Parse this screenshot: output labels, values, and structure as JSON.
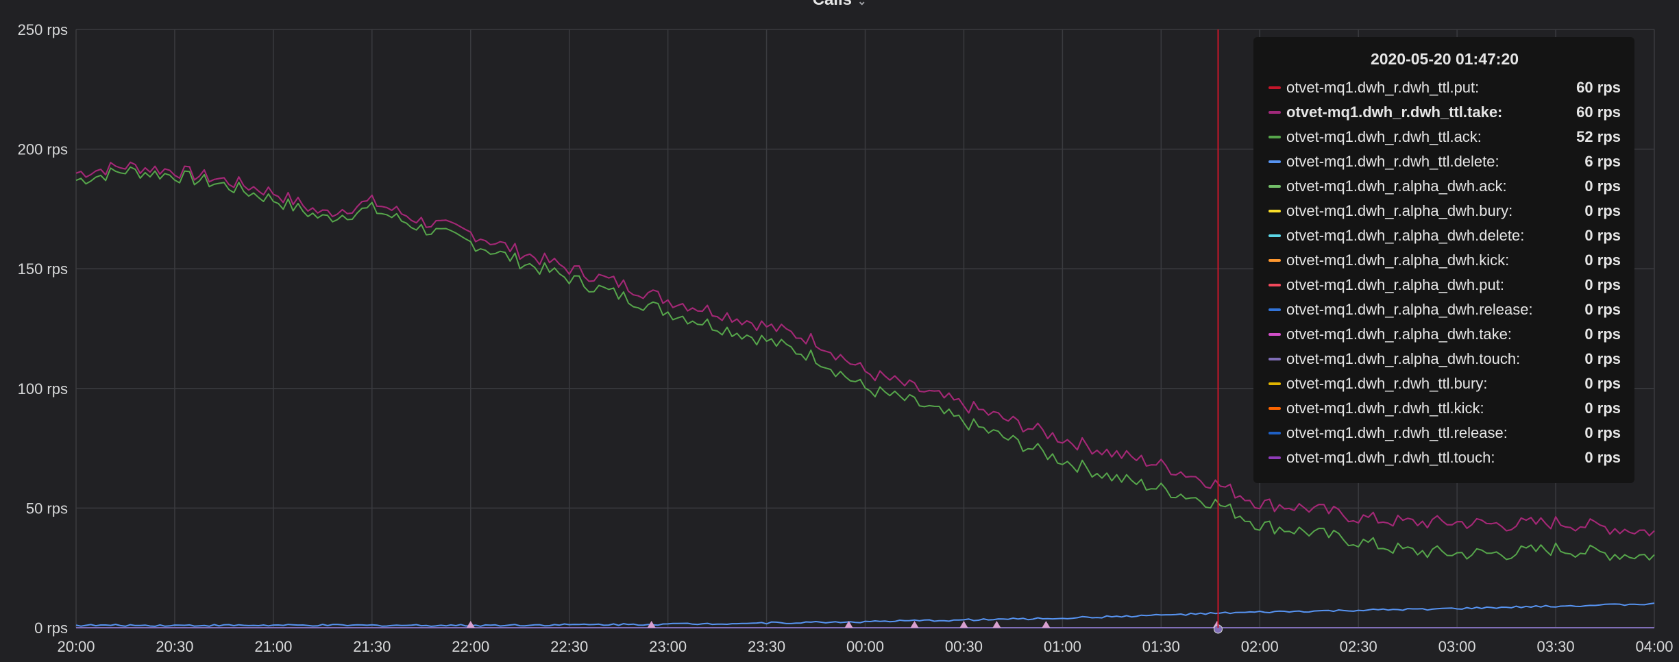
{
  "panel": {
    "title": "Calls",
    "caret": "⌄"
  },
  "chart_data": {
    "type": "line",
    "x_start": "20:00",
    "x_end": "04:00",
    "x_ticks": [
      "20:00",
      "20:30",
      "21:00",
      "21:30",
      "22:00",
      "22:30",
      "23:00",
      "23:30",
      "00:00",
      "00:30",
      "01:00",
      "01:30",
      "02:00",
      "02:30",
      "03:00",
      "03:30",
      "04:00"
    ],
    "y_unit": "rps",
    "ylim": [
      0,
      250
    ],
    "y_ticks": [
      0,
      50,
      100,
      150,
      200,
      250
    ],
    "y_tick_labels": [
      "0 rps",
      "50 rps",
      "100 rps",
      "150 rps",
      "200 rps",
      "250 rps"
    ],
    "grid": true,
    "crosshair_time": "01:47:20",
    "series": [
      {
        "name": "otvet-mq1.dwh_r.dwh_ttl.take",
        "color": "#a0297a",
        "x": [
          "20:00",
          "20:15",
          "20:30",
          "20:45",
          "21:00",
          "21:15",
          "21:30",
          "21:45",
          "22:00",
          "22:15",
          "22:30",
          "22:45",
          "23:00",
          "23:15",
          "23:30",
          "23:45",
          "00:00",
          "00:15",
          "00:30",
          "00:45",
          "01:00",
          "01:15",
          "01:30",
          "01:47",
          "02:00",
          "02:15",
          "02:30",
          "02:45",
          "03:00",
          "03:15",
          "03:30",
          "03:45",
          "04:00"
        ],
        "values": [
          190,
          193,
          191,
          187,
          182,
          173,
          178,
          170,
          165,
          157,
          150,
          144,
          137,
          132,
          126,
          120,
          107,
          100,
          93,
          86,
          79,
          73,
          68,
          60,
          52,
          50,
          46,
          44,
          44,
          43,
          44,
          42,
          40
        ]
      },
      {
        "name": "otvet-mq1.dwh_r.dwh_ttl.put",
        "color": "#c4162a",
        "x": [
          "20:00",
          "20:15",
          "20:30",
          "20:45",
          "21:00",
          "21:15",
          "21:30",
          "21:45",
          "22:00",
          "22:15",
          "22:30",
          "22:45",
          "23:00",
          "23:15",
          "23:30",
          "23:45",
          "00:00",
          "00:15",
          "00:30",
          "00:45",
          "01:00",
          "01:15",
          "01:30",
          "01:47",
          "02:00",
          "02:15",
          "02:30",
          "02:45",
          "03:00",
          "03:15",
          "03:30",
          "03:45",
          "04:00"
        ],
        "values": [
          190,
          193,
          191,
          187,
          182,
          173,
          178,
          170,
          165,
          157,
          150,
          144,
          137,
          132,
          126,
          120,
          107,
          100,
          93,
          86,
          79,
          73,
          68,
          60,
          52,
          50,
          46,
          44,
          44,
          43,
          44,
          42,
          40
        ]
      },
      {
        "name": "otvet-mq1.dwh_r.dwh_ttl.ack",
        "color": "#56a64b",
        "x": [
          "20:00",
          "20:15",
          "20:30",
          "20:45",
          "21:00",
          "21:15",
          "21:30",
          "21:45",
          "22:00",
          "22:15",
          "22:30",
          "22:45",
          "23:00",
          "23:15",
          "23:30",
          "23:45",
          "00:00",
          "00:15",
          "00:30",
          "00:45",
          "01:00",
          "01:15",
          "01:30",
          "01:47",
          "02:00",
          "02:15",
          "02:30",
          "02:45",
          "03:00",
          "03:15",
          "03:30",
          "03:45",
          "04:00"
        ],
        "values": [
          187,
          191,
          189,
          185,
          179,
          171,
          175,
          167,
          161,
          153,
          146,
          139,
          132,
          126,
          120,
          113,
          100,
          94,
          86,
          78,
          70,
          63,
          58,
          52,
          43,
          40,
          36,
          32,
          31,
          31,
          33,
          31,
          30
        ]
      },
      {
        "name": "otvet-mq1.dwh_r.dwh_ttl.delete",
        "color": "#5794f2",
        "x": [
          "20:00",
          "21:00",
          "22:00",
          "23:00",
          "00:00",
          "01:00",
          "01:47",
          "02:00",
          "03:00",
          "04:00"
        ],
        "values": [
          1,
          1,
          1,
          1.5,
          2.5,
          4,
          6,
          6.5,
          8,
          10
        ]
      }
    ],
    "legend": {
      "timestamp": "2020-05-20 01:47:20",
      "placement": "top-right",
      "entries": [
        {
          "name": "otvet-mq1.dwh_r.dwh_ttl.put:",
          "value": "60 rps",
          "color": "#c4162a"
        },
        {
          "name": "otvet-mq1.dwh_r.dwh_ttl.take:",
          "value": "60 rps",
          "color": "#a0297a",
          "highlight": true
        },
        {
          "name": "otvet-mq1.dwh_r.dwh_ttl.ack:",
          "value": "52 rps",
          "color": "#56a64b"
        },
        {
          "name": "otvet-mq1.dwh_r.dwh_ttl.delete:",
          "value": "6 rps",
          "color": "#5794f2"
        },
        {
          "name": "otvet-mq1.dwh_r.alpha_dwh.ack:",
          "value": "0 rps",
          "color": "#73bf69"
        },
        {
          "name": "otvet-mq1.dwh_r.alpha_dwh.bury:",
          "value": "0 rps",
          "color": "#fade2a"
        },
        {
          "name": "otvet-mq1.dwh_r.alpha_dwh.delete:",
          "value": "0 rps",
          "color": "#5cd6e6"
        },
        {
          "name": "otvet-mq1.dwh_r.alpha_dwh.kick:",
          "value": "0 rps",
          "color": "#ff9830"
        },
        {
          "name": "otvet-mq1.dwh_r.alpha_dwh.put:",
          "value": "0 rps",
          "color": "#f2495c"
        },
        {
          "name": "otvet-mq1.dwh_r.alpha_dwh.release:",
          "value": "0 rps",
          "color": "#3274d9"
        },
        {
          "name": "otvet-mq1.dwh_r.alpha_dwh.take:",
          "value": "0 rps",
          "color": "#d14fc8"
        },
        {
          "name": "otvet-mq1.dwh_r.alpha_dwh.touch:",
          "value": "0 rps",
          "color": "#806eb7"
        },
        {
          "name": "otvet-mq1.dwh_r.dwh_ttl.bury:",
          "value": "0 rps",
          "color": "#e0b400"
        },
        {
          "name": "otvet-mq1.dwh_r.dwh_ttl.kick:",
          "value": "0 rps",
          "color": "#fa6400"
        },
        {
          "name": "otvet-mq1.dwh_r.dwh_ttl.release:",
          "value": "0 rps",
          "color": "#1f60c4"
        },
        {
          "name": "otvet-mq1.dwh_r.dwh_ttl.touch:",
          "value": "0 rps",
          "color": "#8f3bb8"
        }
      ]
    }
  }
}
